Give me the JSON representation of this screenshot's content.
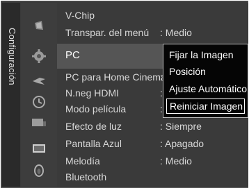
{
  "sidebar": {
    "label": "Configuración"
  },
  "menu": {
    "items": [
      {
        "label": "V-Chip",
        "value": ""
      },
      {
        "label": "Transpar. del menú",
        "value": ": Medio"
      },
      {
        "label": "PC",
        "value": ""
      },
      {
        "label": "PC para Home Cinema",
        "value": ":"
      },
      {
        "label": "N.neg HDMI",
        "value": ":"
      },
      {
        "label": "Modo película",
        "value": ":"
      },
      {
        "label": "Efecto de luz",
        "value": ": Siempre"
      },
      {
        "label": "Pantalla Azul",
        "value": ": Apagado"
      },
      {
        "label": "Melodía",
        "value": ": Medio"
      },
      {
        "label": "Bluetooth",
        "value": ""
      }
    ]
  },
  "popup": {
    "items": [
      "Fijar la Imagen",
      "Posición",
      "Ajuste Automático",
      "Reiniciar Imagen"
    ],
    "selected_index": 3
  },
  "icons": [
    "vchip-icon",
    "gear-icon",
    "bird-icon",
    "clock-icon",
    "monitor-icon",
    "screen-icon",
    "melody-icon"
  ]
}
